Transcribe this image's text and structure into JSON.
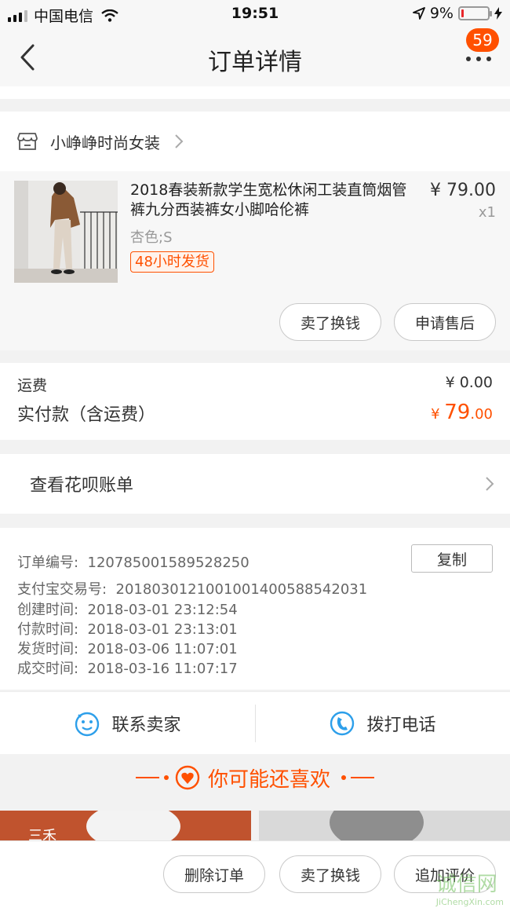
{
  "status": {
    "carrier": "中国电信",
    "time": "19:51",
    "battery": "9%",
    "battery_level": 0.09
  },
  "nav": {
    "title": "订单详情",
    "badge": "59"
  },
  "shop": {
    "name": "小峥峥时尚女装"
  },
  "product": {
    "title": "2018春装新款学生宽松休闲工装直筒烟管裤九分西装裤女小脚哈伦裤",
    "sku": "杏色;S",
    "tag": "48小时发货",
    "price": "¥ 79.00",
    "qty": "x1",
    "actions": [
      "卖了换钱",
      "申请售后"
    ]
  },
  "fees": {
    "shipping_label": "运费",
    "shipping_value": "¥ 0.00",
    "total_label": "实付款（含运费）",
    "total_currency": "¥",
    "total_int": "79",
    "total_dec": ".00"
  },
  "huabei": {
    "label": "查看花呗账单"
  },
  "info": {
    "copy_label": "复制",
    "lines": [
      {
        "label": "订单编号:",
        "value": "120785001589528250"
      },
      {
        "label": "支付宝交易号:",
        "value": "2018030121001001400588542031"
      },
      {
        "label": "创建时间:",
        "value": "2018-03-01 23:12:54"
      },
      {
        "label": "付款时间:",
        "value": "2018-03-01 23:13:01"
      },
      {
        "label": "发货时间:",
        "value": "2018-03-06 11:07:01"
      },
      {
        "label": "成交时间:",
        "value": "2018-03-16 11:07:17"
      }
    ]
  },
  "contact": {
    "seller": "联系卖家",
    "phone": "拨打电话"
  },
  "recommend": {
    "title": "你可能还喜欢",
    "left_text": "三禾"
  },
  "bottom": {
    "actions": [
      "删除订单",
      "卖了换钱",
      "追加评价"
    ]
  },
  "watermark": {
    "text": "诚信网",
    "sub": "JiChengXin.com"
  },
  "colors": {
    "accent": "#ff5000",
    "background": "#f2f2f2"
  }
}
